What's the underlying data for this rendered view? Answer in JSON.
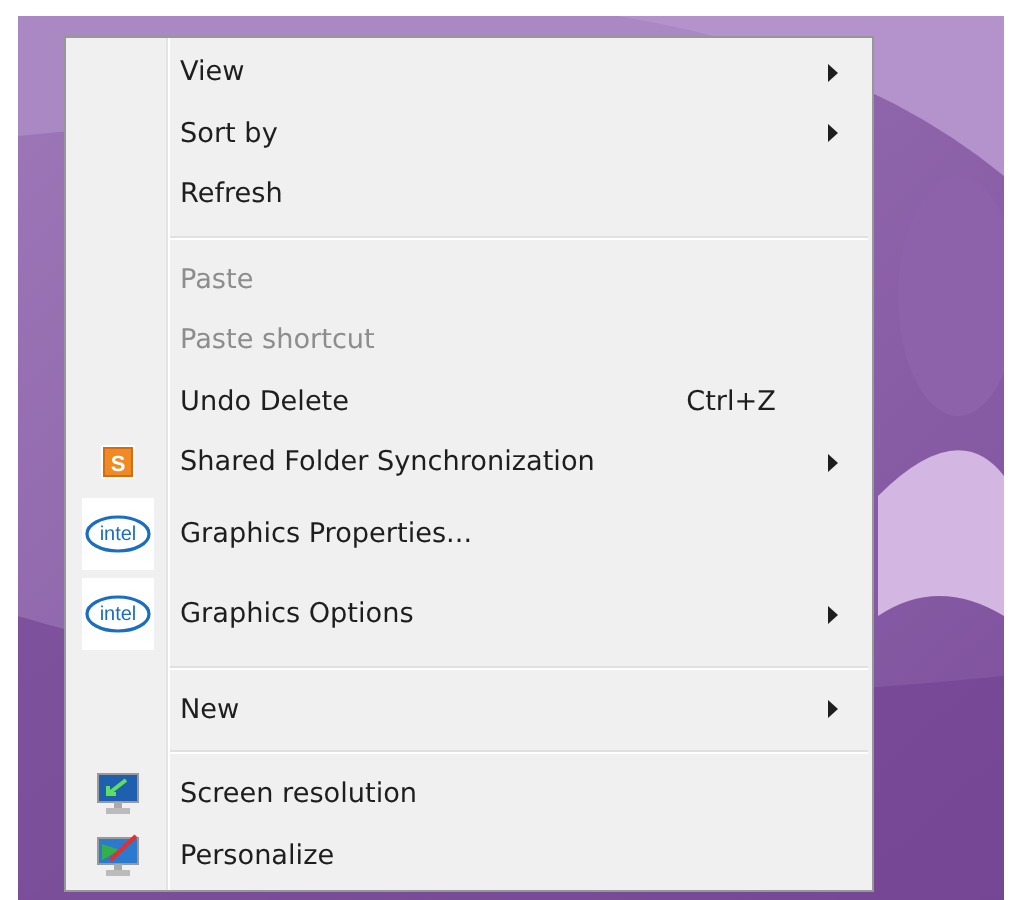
{
  "context_menu": {
    "items": [
      {
        "kind": "plain",
        "label": "View",
        "submenu": true,
        "disabled": false
      },
      {
        "kind": "plain",
        "label": "Sort by",
        "submenu": true,
        "disabled": false
      },
      {
        "kind": "plain",
        "label": "Refresh",
        "submenu": false,
        "disabled": false
      },
      {
        "kind": "separator"
      },
      {
        "kind": "plain",
        "label": "Paste",
        "submenu": false,
        "disabled": true
      },
      {
        "kind": "plain",
        "label": "Paste shortcut",
        "submenu": false,
        "disabled": true
      },
      {
        "kind": "plain",
        "label": "Undo Delete",
        "shortcut": "Ctrl+Z",
        "submenu": false,
        "disabled": false
      },
      {
        "kind": "square",
        "icon_text": "S",
        "label": "Shared Folder Synchronization",
        "submenu": true,
        "disabled": false
      },
      {
        "kind": "logo",
        "icon_text": "intel",
        "label": "Graphics Properties...",
        "submenu": false,
        "disabled": false
      },
      {
        "kind": "logo",
        "icon_text": "intel",
        "label": "Graphics Options",
        "submenu": true,
        "disabled": false
      },
      {
        "kind": "separator"
      },
      {
        "kind": "plain",
        "label": "New",
        "submenu": true,
        "disabled": false
      },
      {
        "kind": "separator"
      },
      {
        "kind": "monitor",
        "label": "Screen resolution",
        "submenu": false,
        "disabled": false
      },
      {
        "kind": "palette",
        "label": "Personalize",
        "submenu": false,
        "disabled": false
      }
    ]
  }
}
